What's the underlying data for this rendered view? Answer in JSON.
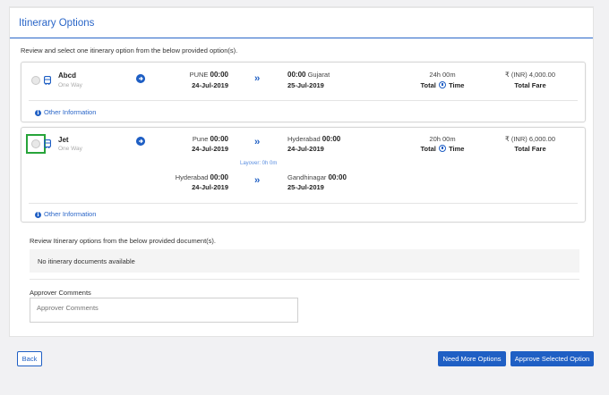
{
  "header": {
    "title": "Itinerary Options"
  },
  "instruction": "Review and select one itinerary option from the below provided option(s).",
  "options": [
    {
      "airline": "Abcd",
      "trip_type": "One Way",
      "legs": [
        {
          "from_city": "PUNE",
          "from_time": "00:00",
          "from_date": "24-Jul-2019",
          "to_city": "Gujarat",
          "to_time": "00:00",
          "to_date": "25-Jul-2019"
        }
      ],
      "duration": "24h 00m",
      "duration_label": "Total",
      "duration_label_suffix": "Time",
      "fare": "₹ (INR) 4,000.00",
      "fare_label": "Total Fare",
      "info_link": "Other Information",
      "selected": false
    },
    {
      "airline": "Jet",
      "trip_type": "One Way",
      "legs": [
        {
          "from_city": "Pune",
          "from_time": "00:00",
          "from_date": "24-Jul-2019",
          "to_city": "Hyderabad",
          "to_time": "00:00",
          "to_date": "24-Jul-2019"
        },
        {
          "from_city": "Hyderabad",
          "from_time": "00:00",
          "from_date": "24-Jul-2019",
          "to_city": "Gandhinagar",
          "to_time": "00:00",
          "to_date": "25-Jul-2019"
        }
      ],
      "layover": "Layover: 0h 0m",
      "duration": "20h 00m",
      "duration_label": "Total",
      "duration_label_suffix": "Time",
      "fare": "₹ (INR) 6,000.00",
      "fare_label": "Total Fare",
      "info_link": "Other Information",
      "selected": false
    }
  ],
  "documents": {
    "title": "Review Itinerary options from the below provided document(s).",
    "empty_text": "No itinerary documents available"
  },
  "comments": {
    "label": "Approver Comments",
    "placeholder": "Approver Comments",
    "value": ""
  },
  "buttons": {
    "back": "Back",
    "need_more": "Need More Options",
    "approve": "Approve Selected Option"
  },
  "colors": {
    "accent": "#1f5fc4",
    "highlight": "#27a43a"
  },
  "icons": {
    "transport": "bus-icon",
    "details": "arrow-circle-right-icon",
    "route": "double-chevron-right-icon",
    "time": "clock-icon",
    "info": "info-icon"
  }
}
